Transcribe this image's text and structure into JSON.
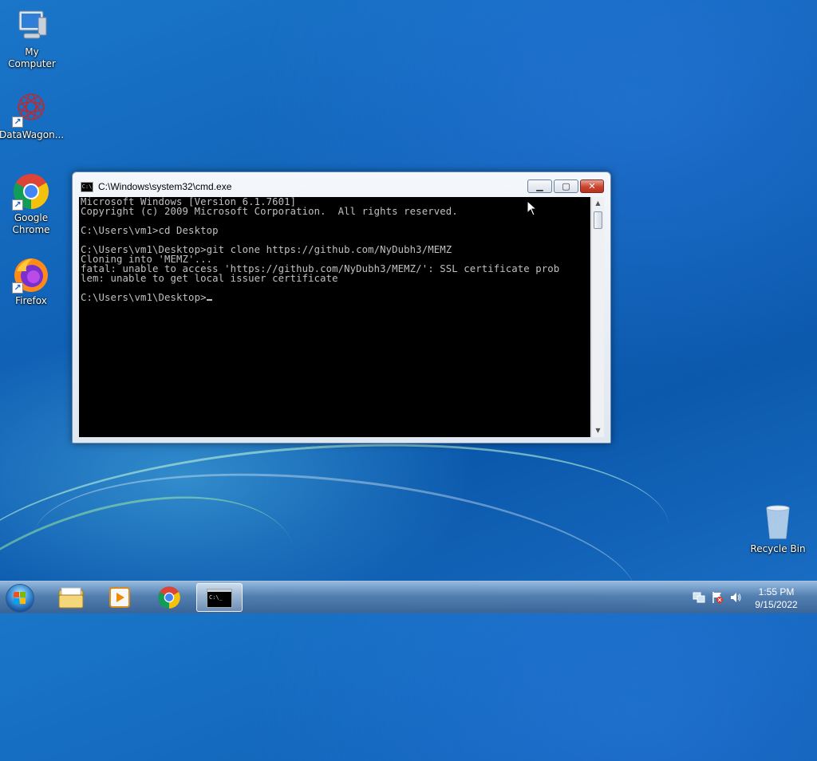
{
  "desktop": {
    "icons": [
      {
        "label": "My Computer",
        "icon": "computer-icon"
      },
      {
        "label": "DataWagon...",
        "icon": "datawagon-icon"
      },
      {
        "label": "Google Chrome",
        "icon": "chrome-icon"
      },
      {
        "label": "Firefox",
        "icon": "firefox-icon"
      },
      {
        "label": "Recycle Bin",
        "icon": "recycle-bin-icon"
      }
    ]
  },
  "cmd_window": {
    "title": "C:\\Windows\\system32\\cmd.exe",
    "console_lines": [
      "Microsoft Windows [Version 6.1.7601]",
      "Copyright (c) 2009 Microsoft Corporation.  All rights reserved.",
      "",
      "C:\\Users\\vm1>cd Desktop",
      "",
      "C:\\Users\\vm1\\Desktop>git clone https://github.com/NyDubh3/MEMZ",
      "Cloning into 'MEMZ'...",
      "fatal: unable to access 'https://github.com/NyDubh3/MEMZ/': SSL certificate prob",
      "lem: unable to get local issuer certificate",
      ""
    ],
    "prompt": "C:\\Users\\vm1\\Desktop>",
    "icons": {
      "minimize": "minimize-icon",
      "maximize": "maximize-icon",
      "close": "close-icon"
    }
  },
  "taskbar": {
    "items": [
      {
        "icon": "windows-start-icon"
      },
      {
        "icon": "file-explorer-icon"
      },
      {
        "icon": "media-player-icon"
      },
      {
        "icon": "chrome-icon"
      },
      {
        "icon": "cmd-icon",
        "active": true
      }
    ],
    "tray_icons": [
      "network-icon",
      "action-center-icon",
      "volume-icon"
    ],
    "clock": {
      "time": "1:55 PM",
      "date": "9/15/2022"
    }
  }
}
